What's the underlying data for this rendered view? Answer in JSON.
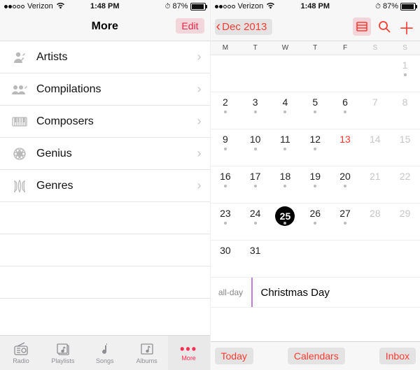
{
  "status": {
    "carrier": "Verizon",
    "time": "1:48 PM",
    "battery_pct": "87%"
  },
  "music": {
    "title": "More",
    "edit_label": "Edit",
    "items": [
      {
        "icon": "artist-icon",
        "label": "Artists"
      },
      {
        "icon": "compilations-icon",
        "label": "Compilations"
      },
      {
        "icon": "composers-icon",
        "label": "Composers"
      },
      {
        "icon": "genius-icon",
        "label": "Genius"
      },
      {
        "icon": "genres-icon",
        "label": "Genres"
      }
    ],
    "tabs": [
      {
        "label": "Radio"
      },
      {
        "label": "Playlists"
      },
      {
        "label": "Songs"
      },
      {
        "label": "Albums"
      },
      {
        "label": "More",
        "selected": true
      }
    ]
  },
  "calendar": {
    "back_label": "Dec 2013",
    "dow": [
      "M",
      "T",
      "W",
      "T",
      "F",
      "S",
      "S"
    ],
    "weeks": [
      [
        {
          "n": "",
          "cls": "empty"
        },
        {
          "n": "",
          "cls": "empty"
        },
        {
          "n": "",
          "cls": "empty"
        },
        {
          "n": "",
          "cls": "empty"
        },
        {
          "n": "",
          "cls": "empty"
        },
        {
          "n": "",
          "cls": "empty"
        },
        {
          "n": "1",
          "cls": "wkend",
          "dot": true
        }
      ],
      [
        {
          "n": "2",
          "dot": true
        },
        {
          "n": "3",
          "dot": true
        },
        {
          "n": "4",
          "dot": true
        },
        {
          "n": "5",
          "dot": true
        },
        {
          "n": "6",
          "dot": true
        },
        {
          "n": "7",
          "cls": "wkend"
        },
        {
          "n": "8",
          "cls": "wkend"
        }
      ],
      [
        {
          "n": "9",
          "dot": true
        },
        {
          "n": "10",
          "dot": true
        },
        {
          "n": "11",
          "dot": true
        },
        {
          "n": "12",
          "dot": true
        },
        {
          "n": "13",
          "cls": "red"
        },
        {
          "n": "14",
          "cls": "wkend"
        },
        {
          "n": "15",
          "cls": "wkend"
        }
      ],
      [
        {
          "n": "16",
          "dot": true
        },
        {
          "n": "17",
          "dot": true
        },
        {
          "n": "18",
          "dot": true
        },
        {
          "n": "19",
          "dot": true
        },
        {
          "n": "20",
          "dot": true
        },
        {
          "n": "21",
          "cls": "wkend"
        },
        {
          "n": "22",
          "cls": "wkend"
        }
      ],
      [
        {
          "n": "23",
          "dot": true
        },
        {
          "n": "24",
          "dot": true
        },
        {
          "n": "25",
          "sel": true,
          "dot": true
        },
        {
          "n": "26",
          "dot": true
        },
        {
          "n": "27",
          "dot": true
        },
        {
          "n": "28",
          "cls": "wkend"
        },
        {
          "n": "29",
          "cls": "wkend"
        }
      ],
      [
        {
          "n": "30"
        },
        {
          "n": "31"
        },
        {
          "n": "",
          "cls": "empty"
        },
        {
          "n": "",
          "cls": "empty"
        },
        {
          "n": "",
          "cls": "empty"
        },
        {
          "n": "",
          "cls": "empty"
        },
        {
          "n": "",
          "cls": "empty"
        }
      ]
    ],
    "event": {
      "time_label": "all-day",
      "title": "Christmas Day"
    },
    "buttons": {
      "today": "Today",
      "calendars": "Calendars",
      "inbox": "Inbox"
    }
  }
}
